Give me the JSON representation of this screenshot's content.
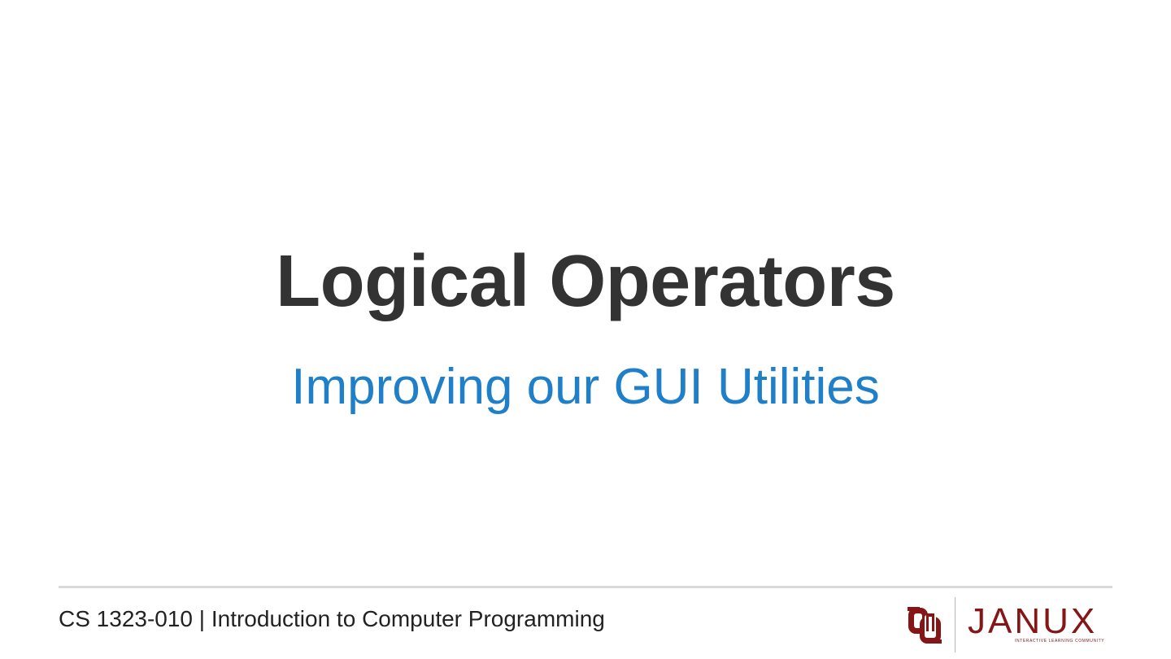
{
  "slide": {
    "title": "Logical Operators",
    "subtitle": "Improving our GUI Utilities"
  },
  "footer": {
    "course_text": "CS 1323-010 | Introduction to Computer Programming",
    "logos": {
      "ou_logo_icon": "ou-interlocking-logo",
      "janux_wordmark": "JANUX",
      "janux_tagline": "INTERACTIVE LEARNING COMMUNITY"
    }
  },
  "colors": {
    "title": "#333333",
    "subtitle": "#1f7fc9",
    "brand_crimson": "#841617",
    "rule": "#d9d9d9"
  }
}
